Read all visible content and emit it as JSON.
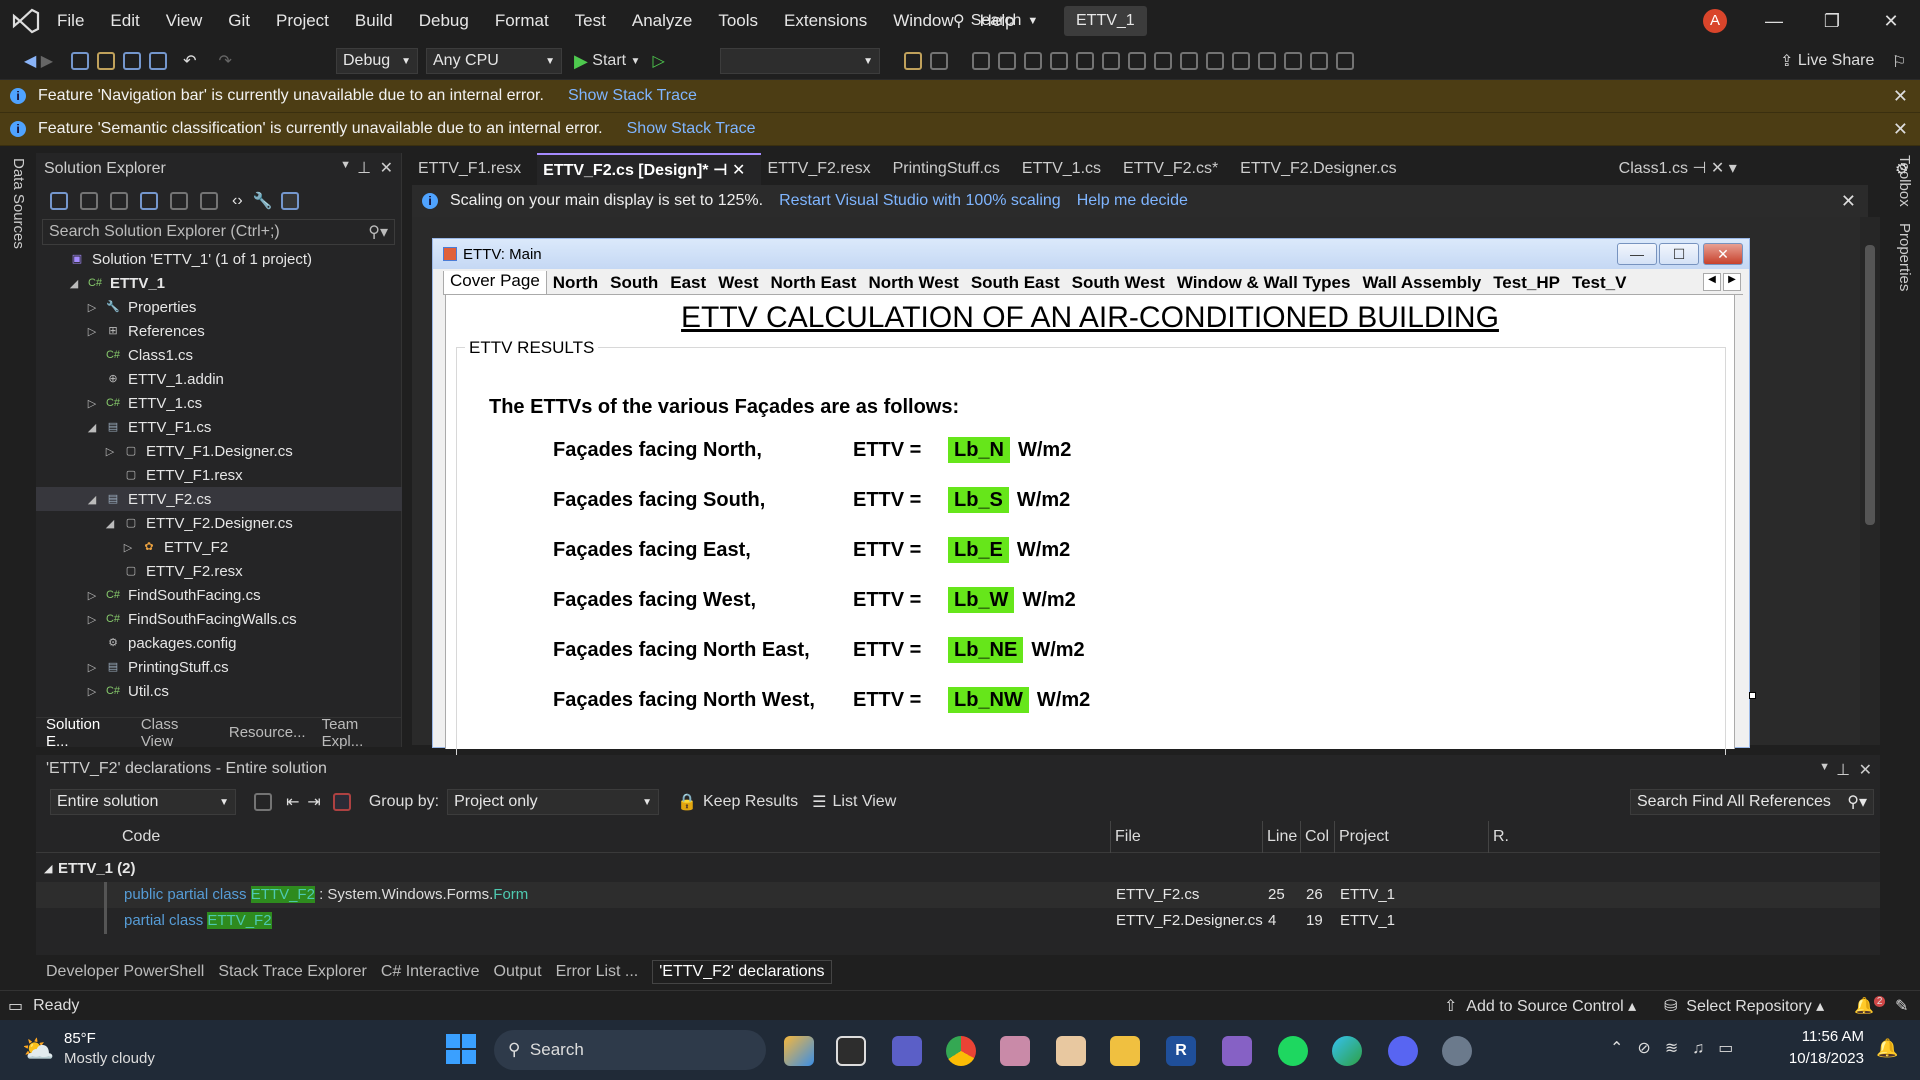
{
  "titlebar": {
    "menu": [
      "File",
      "Edit",
      "View",
      "Git",
      "Project",
      "Build",
      "Debug",
      "Format",
      "Test",
      "Analyze",
      "Tools",
      "Extensions",
      "Window",
      "Help"
    ],
    "search_label": "Search",
    "solution_name": "ETTV_1",
    "avatar_initial": "A"
  },
  "toolbar": {
    "config": "Debug",
    "platform": "Any CPU",
    "start_label": "Start",
    "live_share": "Live Share"
  },
  "infobars": [
    {
      "message": "Feature 'Navigation bar' is currently unavailable due to an internal error.",
      "link": "Show Stack Trace"
    },
    {
      "message": "Feature 'Semantic classification' is currently unavailable due to an internal error.",
      "link": "Show Stack Trace"
    }
  ],
  "left_strip": "Data Sources",
  "right_strip": {
    "toolbox": "Toolbox",
    "properties": "Properties"
  },
  "solution_explorer": {
    "title": "Solution Explorer",
    "search_placeholder": "Search Solution Explorer (Ctrl+;)",
    "tree": [
      {
        "label": "Solution 'ETTV_1' (1 of 1 project)",
        "icon": "solution-icon"
      },
      {
        "label": "ETTV_1",
        "icon": "csharp-project-icon",
        "bold": true
      },
      {
        "label": "Properties",
        "icon": "wrench-icon"
      },
      {
        "label": "References",
        "icon": "references-icon"
      },
      {
        "label": "Class1.cs",
        "icon": "csharp-file-icon"
      },
      {
        "label": "ETTV_1.addin",
        "icon": "addin-file-icon"
      },
      {
        "label": "ETTV_1.cs",
        "icon": "csharp-file-icon"
      },
      {
        "label": "ETTV_F1.cs",
        "icon": "form-icon"
      },
      {
        "label": "ETTV_F1.Designer.cs",
        "icon": "designer-file-icon"
      },
      {
        "label": "ETTV_F1.resx",
        "icon": "resx-file-icon"
      },
      {
        "label": "ETTV_F2.cs",
        "icon": "form-icon"
      },
      {
        "label": "ETTV_F2.Designer.cs",
        "icon": "designer-file-icon"
      },
      {
        "label": "ETTV_F2",
        "icon": "class-icon"
      },
      {
        "label": "ETTV_F2.resx",
        "icon": "resx-file-icon"
      },
      {
        "label": "FindSouthFacing.cs",
        "icon": "csharp-file-icon"
      },
      {
        "label": "FindSouthFacingWalls.cs",
        "icon": "csharp-file-icon"
      },
      {
        "label": "packages.config",
        "icon": "config-file-icon"
      },
      {
        "label": "PrintingStuff.cs",
        "icon": "form-icon"
      },
      {
        "label": "Util.cs",
        "icon": "csharp-file-icon"
      }
    ],
    "tabs": [
      "Solution E...",
      "Class View",
      "Resource...",
      "Team Expl..."
    ]
  },
  "doc_tabs": [
    "ETTV_F1.resx",
    "ETTV_F2.cs [Design]*",
    "ETTV_F2.resx",
    "PrintingStuff.cs",
    "ETTV_1.cs",
    "ETTV_F2.cs*",
    "ETTV_F2.Designer.cs",
    "Class1.cs"
  ],
  "scaling_bar": {
    "message": "Scaling on your main display is set to 125%.",
    "link1": "Restart Visual Studio with 100% scaling",
    "link2": "Help me decide"
  },
  "form": {
    "title": "ETTV: Main",
    "tabs": [
      "Cover Page",
      "North",
      "South",
      "East",
      "West",
      "North East",
      "North West",
      "South East",
      "South West",
      "Window & Wall Types",
      "Wall Assembly",
      "Test_HP",
      "Test_V"
    ],
    "heading": "ETTV CALCULATION OF AN AIR-CONDITIONED BUILDING",
    "group_label": "ETTV RESULTS",
    "intro": "The ETTVs of the various Façades are as follows:",
    "rows": [
      {
        "label": "Façades facing North,",
        "eq": "ETTV =",
        "value": "Lb_N",
        "unit": "W/m2"
      },
      {
        "label": "Façades facing South,",
        "eq": "ETTV =",
        "value": "Lb_S",
        "unit": "W/m2"
      },
      {
        "label": "Façades facing East,",
        "eq": "ETTV =",
        "value": "Lb_E",
        "unit": "W/m2"
      },
      {
        "label": "Façades facing West,",
        "eq": "ETTV =",
        "value": "Lb_W",
        "unit": "W/m2"
      },
      {
        "label": "Façades facing North East,",
        "eq": "ETTV =",
        "value": "Lb_NE",
        "unit": "W/m2"
      },
      {
        "label": "Façades facing North West,",
        "eq": "ETTV =",
        "value": "Lb_NW",
        "unit": "W/m2"
      }
    ]
  },
  "find_results": {
    "title": "'ETTV_F2' declarations - Entire solution",
    "scope": "Entire solution",
    "group_by_label": "Group by:",
    "group_by": "Project only",
    "keep_results": "Keep Results",
    "list_view": "List View",
    "search_placeholder": "Search Find All References",
    "columns": {
      "code": "Code",
      "file": "File",
      "line": "Line",
      "col": "Col",
      "project": "Project",
      "r": "R."
    },
    "group": "ETTV_1 (2)",
    "rows": [
      {
        "pre": "public partial class ",
        "hl": "ETTV_F2",
        "post": " : System.Windows.Forms.",
        "type": "Form",
        "file": "ETTV_F2.cs",
        "line": "25",
        "col": "26",
        "project": "ETTV_1"
      },
      {
        "pre": "partial class ",
        "hl": "ETTV_F2",
        "post": "",
        "type": "",
        "file": "ETTV_F2.Designer.cs",
        "line": "4",
        "col": "19",
        "project": "ETTV_1"
      }
    ]
  },
  "bottom_tabs": [
    "Developer PowerShell",
    "Stack Trace Explorer",
    "C# Interactive",
    "Output",
    "Error List ...",
    "'ETTV_F2' declarations"
  ],
  "status": {
    "ready": "Ready",
    "add_source": "Add to Source Control",
    "select_repo": "Select Repository",
    "notif_count": "2"
  },
  "taskbar": {
    "temp": "85°F",
    "weather": "Mostly cloudy",
    "search": "Search",
    "time": "11:56 AM",
    "date": "10/18/2023"
  }
}
